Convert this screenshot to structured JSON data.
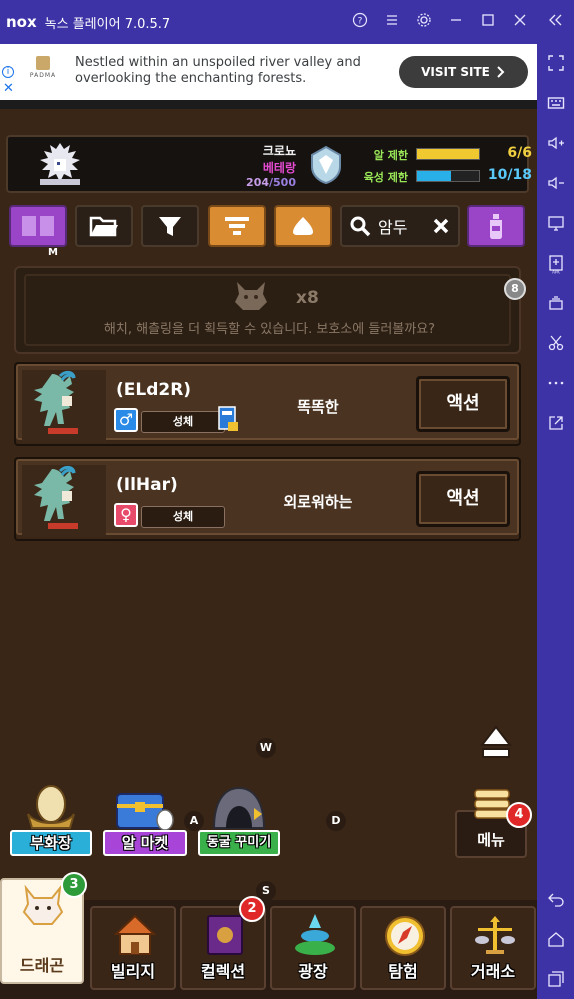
{
  "window": {
    "logo": "nox",
    "title": "녹스 플레이어 7.0.5.7",
    "icons": [
      "help-icon",
      "menu-icon",
      "settings-icon",
      "minimize-icon",
      "maximize-icon",
      "close-icon",
      "collapse-icon"
    ]
  },
  "ad": {
    "brand": "PADMA",
    "text": "Nestled within an unspoiled river valley and overlooking the enchanting forests.",
    "button": "VISIT SITE"
  },
  "dragon_panel": {
    "name_line1": "크로뇨",
    "name_line2": "베테랑",
    "count_current": "204",
    "count_total": "/500",
    "egg_limit_label": "알 제한",
    "egg_limit_value": "6/6",
    "egg_limit_fraction": 1.0,
    "raise_limit_label": "육성 제한",
    "raise_limit_value": "10/18",
    "raise_limit_fraction": 0.55
  },
  "toolbar": {
    "search_value": "암두",
    "hint_key": "M"
  },
  "hatch": {
    "count": "x8",
    "message": "해치, 해츨링을 더 획득할 수 있습니다. 보호소에 들러볼까요?",
    "badge": "8"
  },
  "dragons": [
    {
      "name": "(ELd2R)",
      "gender_symbol": "♂",
      "stage": "성체",
      "trait": "똑똑한",
      "action": "액션"
    },
    {
      "name": "(IlHar)",
      "gender_symbol": "♀",
      "stage": "성체",
      "trait": "외로워하는",
      "action": "액션"
    }
  ],
  "key_hints": {
    "w": "W",
    "a": "A",
    "s": "S",
    "d": "D"
  },
  "quick": {
    "hatchery": "부화장",
    "egg_market": "알 마켓",
    "cave_decor": "동굴 꾸미기",
    "menu": "메뉴",
    "menu_badge": "4"
  },
  "nav": {
    "items": [
      {
        "label": "드래곤",
        "badge": "3"
      },
      {
        "label": "빌리지"
      },
      {
        "label": "컬렉션",
        "badge": "2"
      },
      {
        "label": "광장"
      },
      {
        "label": "탐험"
      },
      {
        "label": "거래소"
      }
    ]
  },
  "colors": {
    "nox_bar": "#3d33a6",
    "game_bg": "#3a2616",
    "egg_bar": "#f0c830",
    "raise_bar": "#2ab0e8",
    "male": "#2a8ae8",
    "female": "#e84a6a"
  }
}
